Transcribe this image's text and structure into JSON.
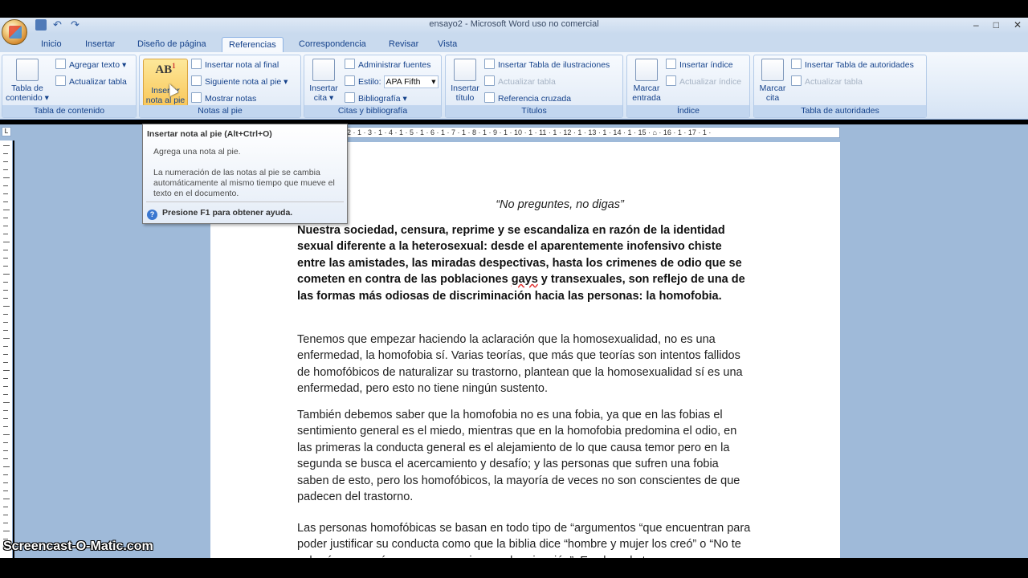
{
  "window": {
    "title": "ensayo2 - Microsoft Word uso no comercial"
  },
  "tabs": [
    {
      "label": "Inicio"
    },
    {
      "label": "Insertar"
    },
    {
      "label": "Diseño de página"
    },
    {
      "label": "Referencias",
      "active": true
    },
    {
      "label": "Correspondencia"
    },
    {
      "label": "Revisar"
    },
    {
      "label": "Vista"
    }
  ],
  "ribbon": {
    "toc": {
      "big_label_1": "Tabla de",
      "big_label_2": "contenido",
      "add_text": "Agregar texto",
      "update_table": "Actualizar tabla",
      "group_label": "Tabla de contenido"
    },
    "footnotes": {
      "big_label_1": "Insertar",
      "big_label_2": "nota al pie",
      "icon_text": "AB",
      "insert_endnote": "Insertar nota al final",
      "next_footnote": "Siguiente nota al pie",
      "show_notes": "Mostrar notas",
      "group_label": "Notas al pie"
    },
    "citations": {
      "big_label_1": "Insertar",
      "big_label_2": "cita",
      "manage_sources": "Administrar fuentes",
      "style_label": "Estilo:",
      "style_value": "APA Fifth",
      "bibliography": "Bibliografía",
      "group_label": "Citas y bibliografía"
    },
    "captions": {
      "big_label_1": "Insertar",
      "big_label_2": "título",
      "insert_table_figures": "Insertar Tabla de ilustraciones",
      "update_table": "Actualizar tabla",
      "cross_reference": "Referencia cruzada",
      "group_label": "Títulos"
    },
    "index": {
      "big_label_1": "Marcar",
      "big_label_2": "entrada",
      "insert_index": "Insertar índice",
      "update_index": "Actualizar índice",
      "group_label": "Índice"
    },
    "authorities": {
      "big_label_1": "Marcar",
      "big_label_2": "cita",
      "insert_table": "Insertar Tabla de autoridades",
      "update_table": "Actualizar tabla",
      "group_label": "Tabla de autoridades"
    }
  },
  "tooltip": {
    "title": "Insertar nota al pie (Alt+Ctrl+O)",
    "description": "Agrega una nota al pie.",
    "detail": "La numeración de las notas al pie se cambia automáticamente al mismo tiempo que mueve el texto en el documento.",
    "help": "Presione F1 para obtener ayuda."
  },
  "ruler": {
    "marks": "2 · 1 · 3 · 1 · 4 · 1 · 5 · 1 · 6 · 1 · 7 · 1 · 8 · 1 · 9 · 1 · 10 · 1 · 11 · 1 · 12 · 1 · 13 · 1 · 14 · 1 · 15 · ⌂ · 16 · 1 · 17 · 1 ·",
    "corner": "L"
  },
  "document": {
    "title": "“No preguntes, no digas”",
    "para1_before": "Nuestra sociedad, censura, reprime y se escandaliza en razón de la identidad sexual diferente a la heterosexual: desde el aparentemente inofensivo chiste entre las amistades, las miradas despectivas,  hasta los crimenes de odio que se cometen en contra de las poblaciones ",
    "para1_wavy": "gays",
    "para1_after": " y transexuales, son reflejo de una de las formas más odiosas de discriminación hacia las personas: la homofobia.",
    "para2": "Tenemos que empezar haciendo la aclaración que la homosexualidad, no es una enfermedad, la homofobia sí. Varias teorías, que más que teorías  son intentos fallidos de homofóbicos de naturalizar su trastorno, plantean que la homosexualidad sí es una enfermedad, pero esto no tiene ningún sustento.",
    "para3": "También debemos saber que la homofobia no es una fobia, ya que en las fobias el sentimiento general es el miedo, mientras que en la homofobia predomina el odio, en las primeras la conducta general es el alejamiento de lo que causa temor pero en la segunda se busca el acercamiento y desafío; y las personas que sufren una fobia saben de esto, pero los homofóbicos, la mayoría de veces no son conscientes de que padecen del trastorno.",
    "para4": "Las personas homofóbicas se basan en todo tipo de “argumentos “que encuentran para poder justificar su conducta como que la biblia dice “hombre y mujer los creó” o “No te echarás con varón, como con mujer, es abominación”. Es absurdo tomar"
  },
  "watermark": "Screencast-O-Matic.com"
}
